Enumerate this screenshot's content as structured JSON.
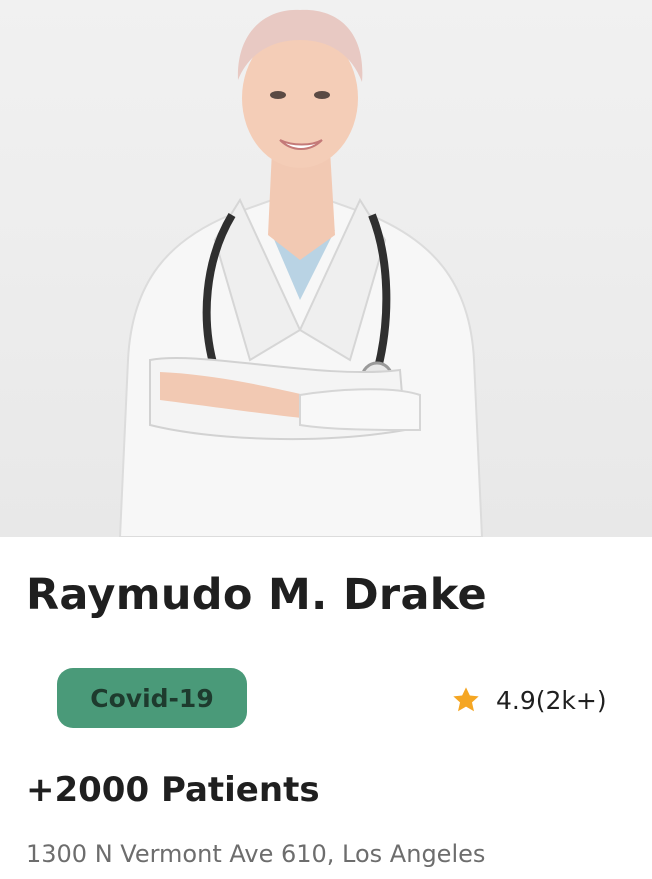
{
  "doctor": {
    "name": "Raymudo M. Drake",
    "tag": "Covid-19",
    "rating": "4.9(2k+)",
    "patients": "+2000 Patients",
    "address": "1300 N Vermont Ave 610, Los Angeles"
  },
  "icons": {
    "rating": "star-icon"
  },
  "colors": {
    "tag_background": "#4a9a79",
    "tag_text": "#1e3b2e",
    "star": "#f5a623",
    "name_text": "#1f1f1f",
    "address_text": "#6d6d6d"
  }
}
